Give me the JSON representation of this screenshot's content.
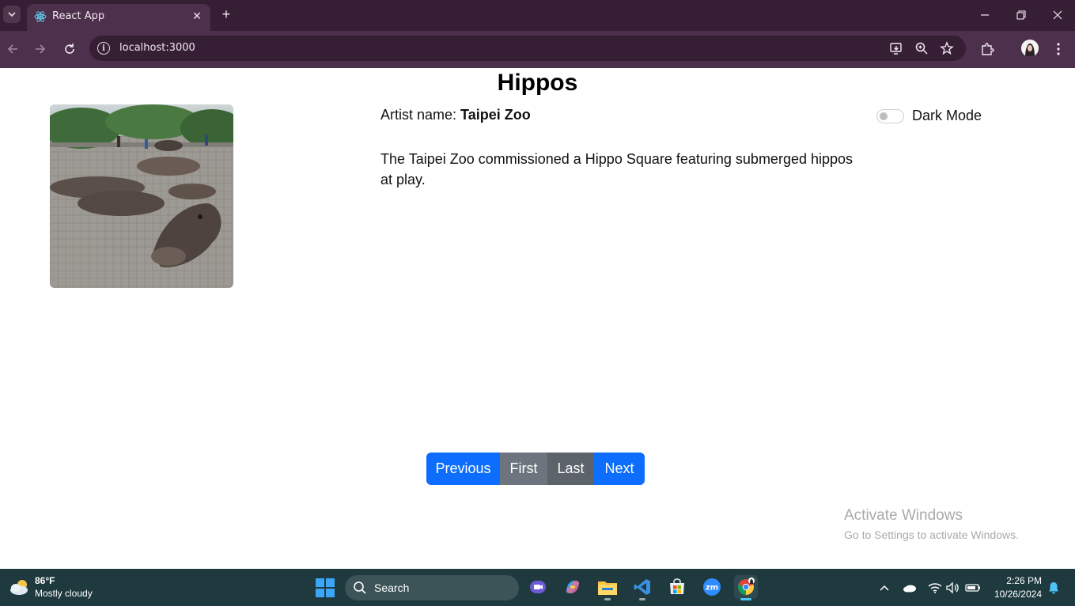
{
  "browser": {
    "tab_title": "React App",
    "url": "localhost:3000"
  },
  "page": {
    "title": "Hippos",
    "artist_label": "Artist name:",
    "artist_name": "Taipei Zoo",
    "description": "The Taipei Zoo commissioned a Hippo Square featuring submerged hippos at play.",
    "dark_mode_label": "Dark Mode",
    "dark_mode_on": false,
    "pagination": {
      "previous": "Previous",
      "first": "First",
      "last": "Last",
      "next": "Next"
    }
  },
  "watermark": {
    "title": "Activate Windows",
    "subtitle": "Go to Settings to activate Windows."
  },
  "taskbar": {
    "weather_temp": "86°F",
    "weather_desc": "Mostly cloudy",
    "search_label": "Search",
    "time": "2:26 PM",
    "date": "10/26/2024"
  },
  "colors": {
    "primary_button": "#0d6efd",
    "secondary_button": "#6c757d",
    "browser_frame": "#361f35",
    "taskbar": "#1e3a3f"
  }
}
